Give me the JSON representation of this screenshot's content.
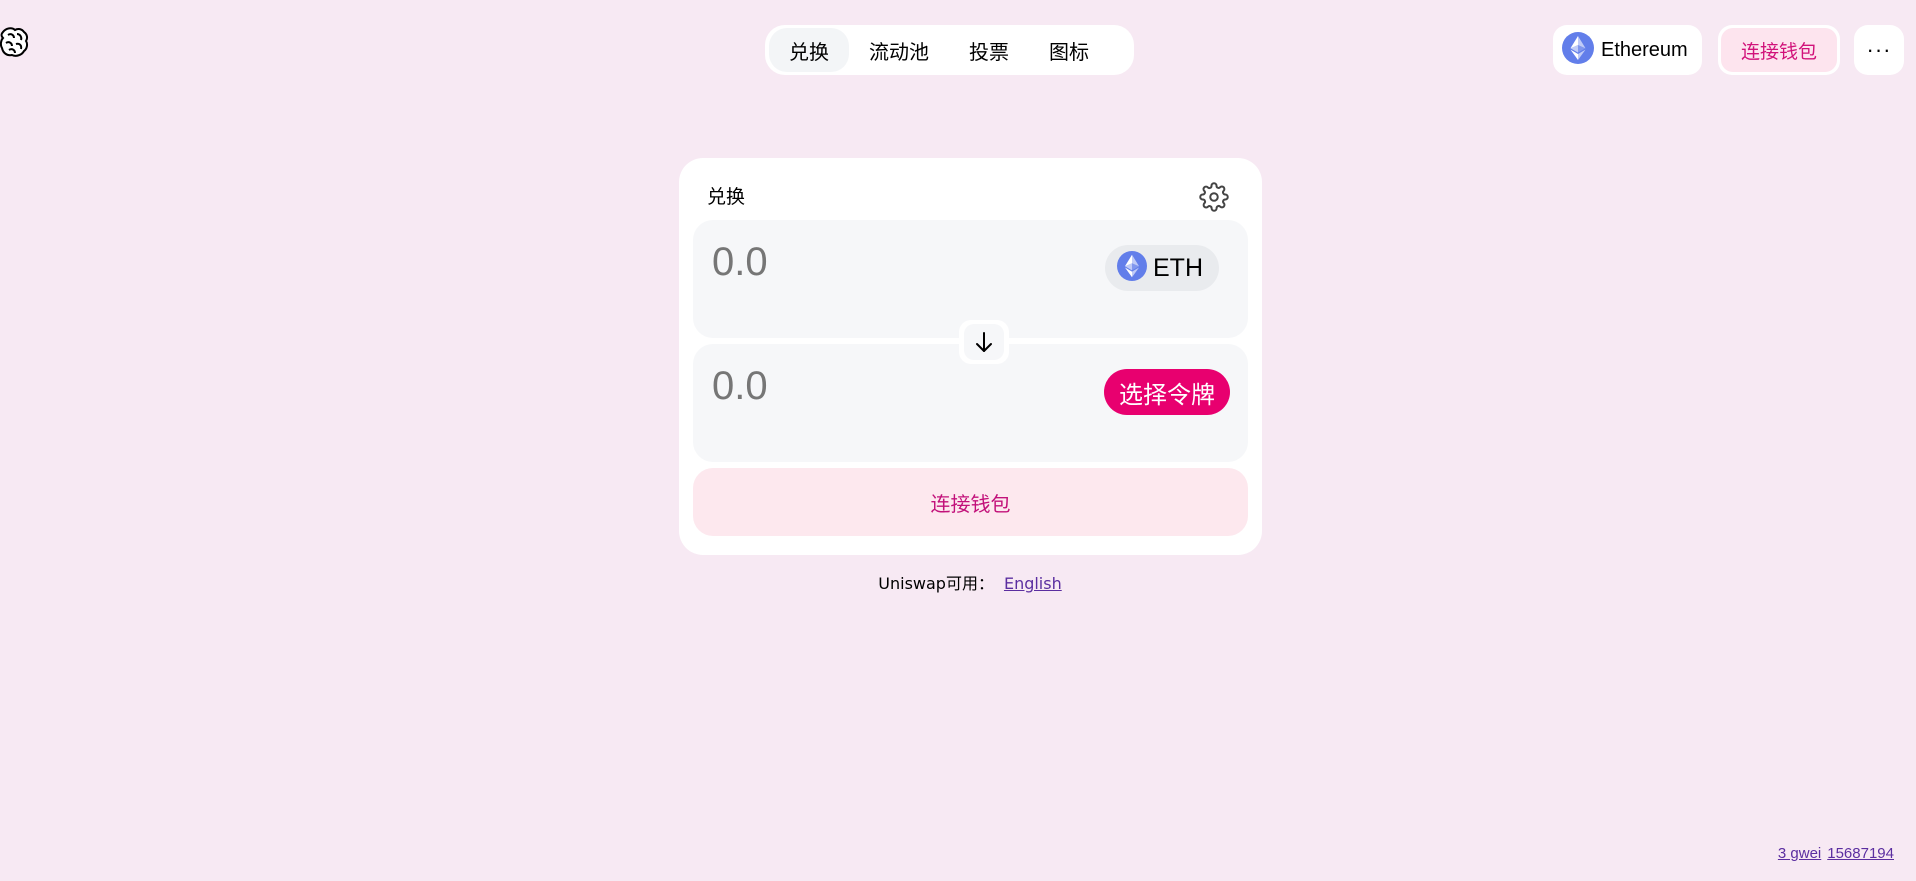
{
  "header": {
    "logo_icon": "unicorn-logo-icon",
    "nav_tabs": [
      {
        "label": "兑换",
        "active": true
      },
      {
        "label": "流动池",
        "active": false
      },
      {
        "label": "投票",
        "active": false
      },
      {
        "label": "图标",
        "active": false
      }
    ],
    "network": {
      "label": "Ethereum",
      "icon": "ethereum-icon"
    },
    "connect_wallet_label": "连接钱包",
    "more_label": "···"
  },
  "swap": {
    "title": "兑换",
    "settings_icon": "gear-icon",
    "input": {
      "placeholder": "0.0",
      "token_label": "ETH",
      "token_icon": "ethereum-icon"
    },
    "output": {
      "placeholder": "0.0",
      "select_token_label": "选择令牌"
    },
    "switch_icon": "arrow-down-icon",
    "connect_wallet_label": "连接钱包"
  },
  "footer": {
    "available_text": "Uniswap可用：",
    "language_link": "English",
    "gas_link": "3 gwei",
    "block_link": "15687194"
  },
  "colors": {
    "background": "#f7e9f3",
    "accent_pink": "#e8006f",
    "connect_text": "#c2117a",
    "connect_bg": "#fde8ee",
    "link": "#5b2ea0"
  }
}
